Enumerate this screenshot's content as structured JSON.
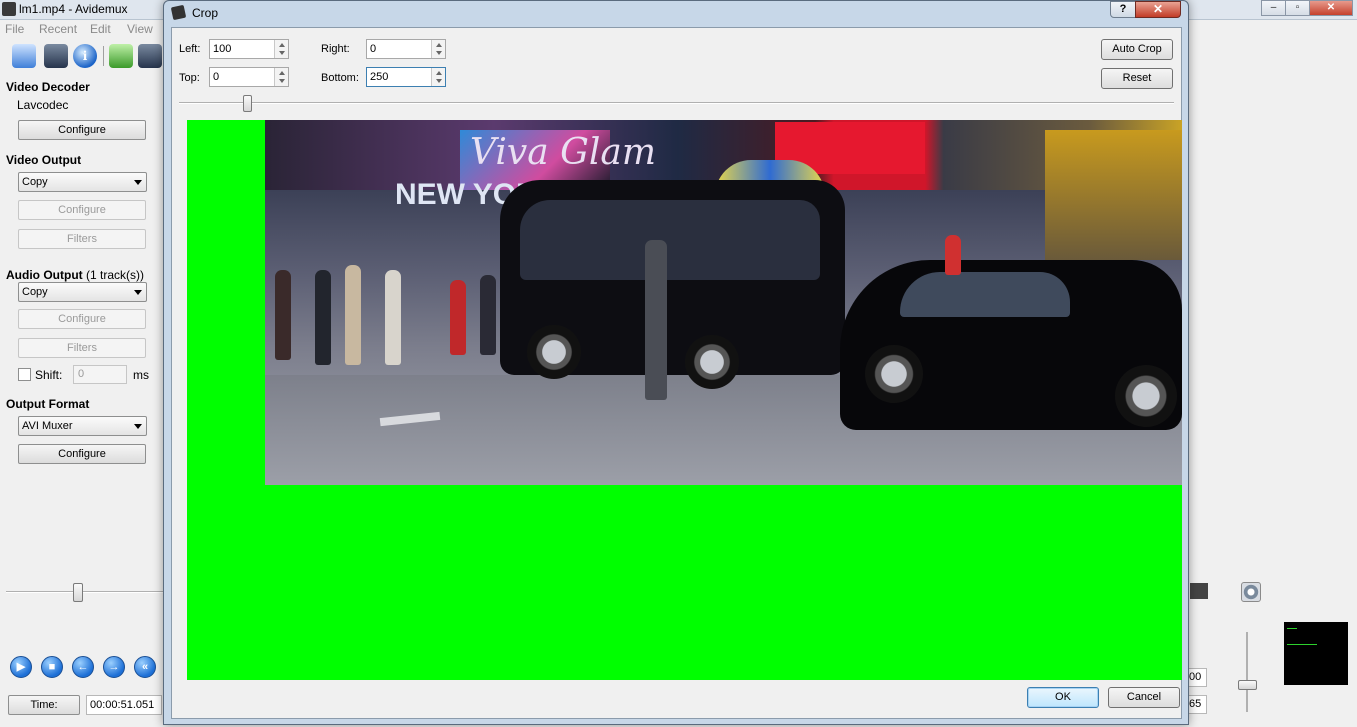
{
  "main_window": {
    "title": "lm1.mp4 - Avidemux",
    "menu": [
      "File",
      "Recent",
      "Edit",
      "View"
    ],
    "video_decoder": {
      "heading": "Video Decoder",
      "codec": "Lavcodec",
      "configure": "Configure"
    },
    "video_output": {
      "heading": "Video Output",
      "codec": "Copy",
      "configure": "Configure",
      "filters": "Filters"
    },
    "audio_output": {
      "heading": "Audio Output",
      "tracks": "(1 track(s))",
      "codec": "Copy",
      "configure": "Configure",
      "filters": "Filters",
      "shift_label": "Shift:",
      "shift_value": "0",
      "shift_unit": "ms"
    },
    "output_format": {
      "heading": "Output Format",
      "muxer": "AVI Muxer",
      "configure": "Configure"
    },
    "time_button": "Time:",
    "time_value": "00:00:51.051",
    "right_partial_a": "00",
    "right_partial_b": "65"
  },
  "crop_dialog": {
    "title": "Crop",
    "help": "?",
    "close": "✕",
    "left_label": "Left:",
    "left_value": "100",
    "right_label": "Right:",
    "right_value": "0",
    "top_label": "Top:",
    "top_value": "0",
    "bottom_label": "Bottom:",
    "bottom_value": "250",
    "auto_crop": "Auto Crop",
    "reset": "Reset",
    "ok": "OK",
    "cancel": "Cancel",
    "mask_color": "#00ff00",
    "preview_signs": [
      "Viva Glam",
      "NEW YORK POWER"
    ]
  },
  "colors": {
    "accent_blue": "#1d6fd6",
    "window_frame": "#c7d7e8",
    "close_red": "#c23c27"
  }
}
